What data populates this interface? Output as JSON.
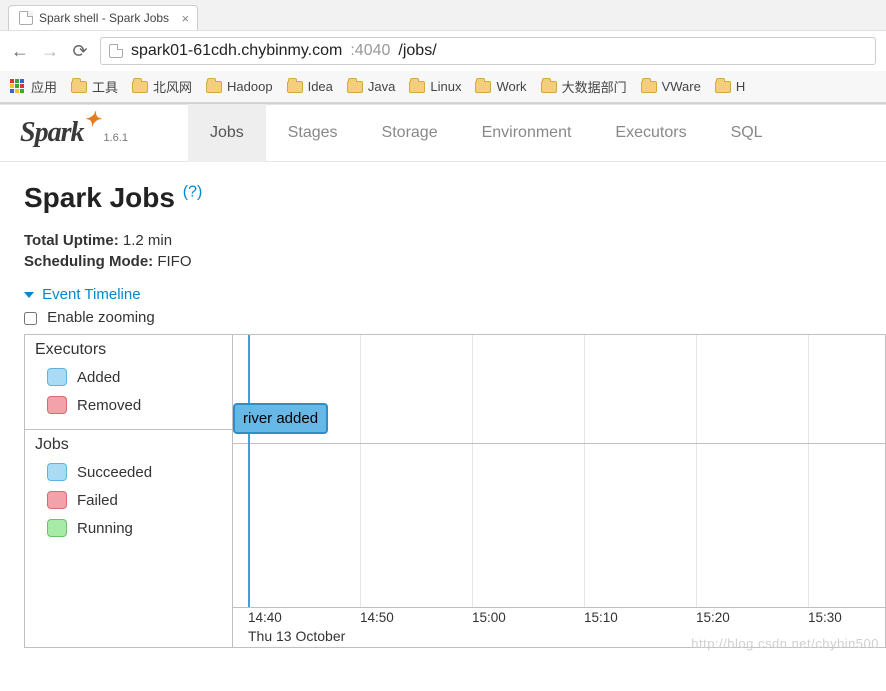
{
  "browser": {
    "tab_title": "Spark shell - Spark Jobs",
    "url_host": "spark01-61cdh.chybinmy.com",
    "url_port": ":4040",
    "url_path": "/jobs/",
    "apps_label": "应用",
    "bookmarks": [
      "工具",
      "北风网",
      "Hadoop",
      "Idea",
      "Java",
      "Linux",
      "Work",
      "大数据部门",
      "VWare",
      "H"
    ]
  },
  "spark": {
    "version": "1.6.1",
    "tabs": [
      "Jobs",
      "Stages",
      "Storage",
      "Environment",
      "Executors",
      "SQL"
    ],
    "active_tab": "Jobs"
  },
  "page": {
    "title": "Spark Jobs",
    "help": "(?)",
    "uptime_label": "Total Uptime:",
    "uptime_value": "1.2 min",
    "sched_label": "Scheduling Mode:",
    "sched_value": "FIFO",
    "timeline_header": "Event Timeline",
    "enable_zoom": "Enable zooming"
  },
  "timeline": {
    "groups": [
      {
        "title": "Executors",
        "legend": [
          {
            "label": "Added",
            "cls": "sw-added"
          },
          {
            "label": "Removed",
            "cls": "sw-removed"
          }
        ]
      },
      {
        "title": "Jobs",
        "legend": [
          {
            "label": "Succeeded",
            "cls": "sw-succeeded"
          },
          {
            "label": "Failed",
            "cls": "sw-failed"
          },
          {
            "label": "Running",
            "cls": "sw-running"
          }
        ]
      }
    ],
    "event_label": "river added",
    "ticks": [
      "14:40",
      "14:50",
      "15:00",
      "15:10",
      "15:20",
      "15:30"
    ],
    "date": "Thu 13 October"
  },
  "watermark": "http://blog.csdn.net/chybin500"
}
